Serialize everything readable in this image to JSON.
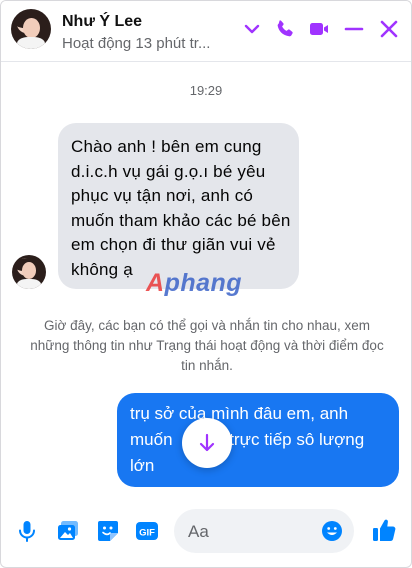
{
  "header": {
    "name": "Như Ý Lee",
    "status": "Hoạt động 13 phút tr...",
    "icons": [
      "chevron-down-icon",
      "phone-icon",
      "video-icon",
      "minimize-icon",
      "close-icon"
    ],
    "accent_color": "#a033ff"
  },
  "conversation": {
    "timestamp": "19:29",
    "incoming": {
      "text": "Chào anh !  bên em cung d.i.c.h vụ gái g.ọ.ı  bé yêu phục vụ tận nơi, anh có muốn tham khảo các bé bên em chọn đi thư giãn vui vẻ không ạ",
      "bubble_color": "#e4e6eb"
    },
    "watermark": {
      "prefix": "A",
      "rest": "phang"
    },
    "notice": "Giờ đây, các bạn có thể gọi và nhắn tin cho nhau, xem những thông tin như Trạng thái hoạt động và thời điểm đọc tin nhắn.",
    "outgoing": {
      "text": "trụ sở của mình đâu em, anh muốn            trực tiếp sô lượng lớn",
      "bubble_color": "#1877f2"
    }
  },
  "composer": {
    "placeholder": "Aa",
    "value": "",
    "icons": [
      "microphone-icon",
      "image-icon",
      "sticker-icon",
      "gif-icon",
      "emoji-icon",
      "like-icon"
    ],
    "gif_label": "GIF"
  },
  "colors": {
    "messenger_blue": "#1877f2",
    "icon_blue": "#0084ff",
    "watermark_red": "#ea3a3a",
    "watermark_blue": "#3b63c8"
  }
}
